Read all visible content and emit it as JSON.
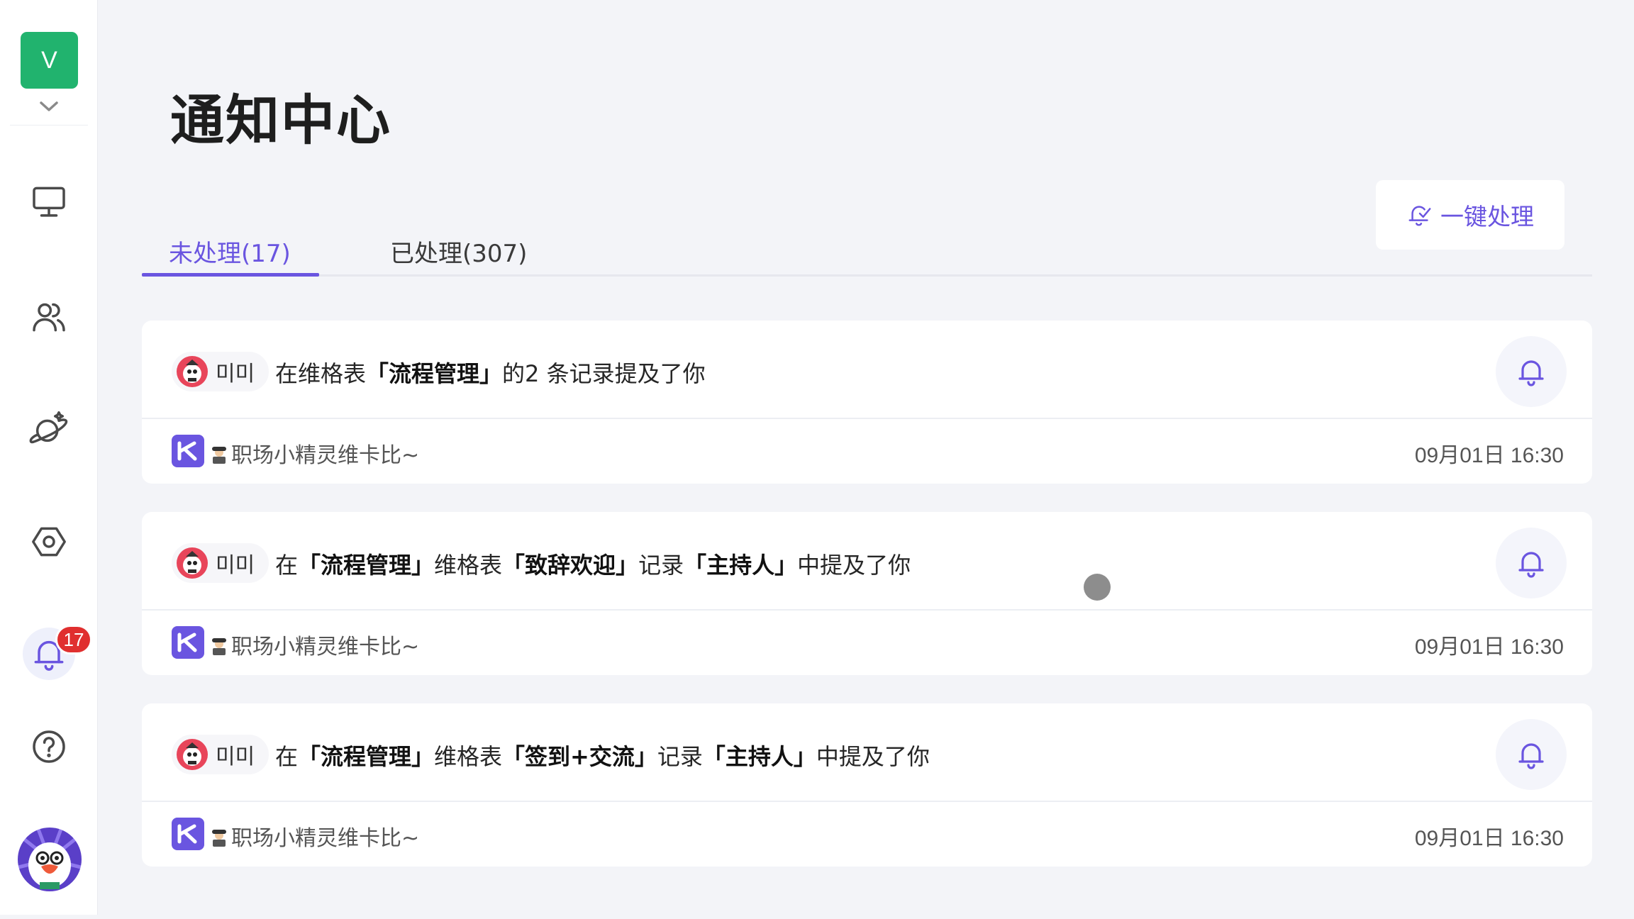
{
  "sidebar": {
    "space_initial": "V",
    "notification_badge": "17",
    "nav_items": [
      {
        "icon": "monitor-icon"
      },
      {
        "icon": "users-icon"
      },
      {
        "icon": "planet-icon"
      },
      {
        "icon": "hexagon-settings-icon"
      },
      {
        "icon": "bell-icon"
      },
      {
        "icon": "help-circle-icon"
      }
    ]
  },
  "page": {
    "title": "通知中心",
    "tabs": [
      {
        "label": "未处理(17)",
        "active": true
      },
      {
        "label": "已处理(307)",
        "active": false
      }
    ],
    "one_click_label": "一键处理"
  },
  "notifications": [
    {
      "user": "미미",
      "message_parts": [
        "在维格表",
        "「流程管理」",
        "的2 条记录提及了你"
      ],
      "bold_mask": [
        false,
        true,
        false
      ],
      "source": "职场小精灵维卡比~",
      "time": "09月01日 16:30"
    },
    {
      "user": "미미",
      "message_parts": [
        "在",
        "「流程管理」",
        "维格表",
        "「致辞欢迎」",
        "记录",
        "「主持人」",
        "中提及了你"
      ],
      "bold_mask": [
        false,
        true,
        false,
        true,
        false,
        true,
        false
      ],
      "source": "职场小精灵维卡比~",
      "time": "09月01日 16:30"
    },
    {
      "user": "미미",
      "message_parts": [
        "在",
        "「流程管理」",
        "维格表",
        "「签到+交流」",
        "记录",
        "「主持人」",
        "中提及了你"
      ],
      "bold_mask": [
        false,
        true,
        false,
        true,
        false,
        true,
        false
      ],
      "source": "职场小精灵维卡比~",
      "time": "09月01日 16:30"
    }
  ],
  "colors": {
    "accent": "#6a55e0",
    "space_tile": "#21b36e",
    "badge": "#e02f2f",
    "background": "#f3f4f8"
  }
}
